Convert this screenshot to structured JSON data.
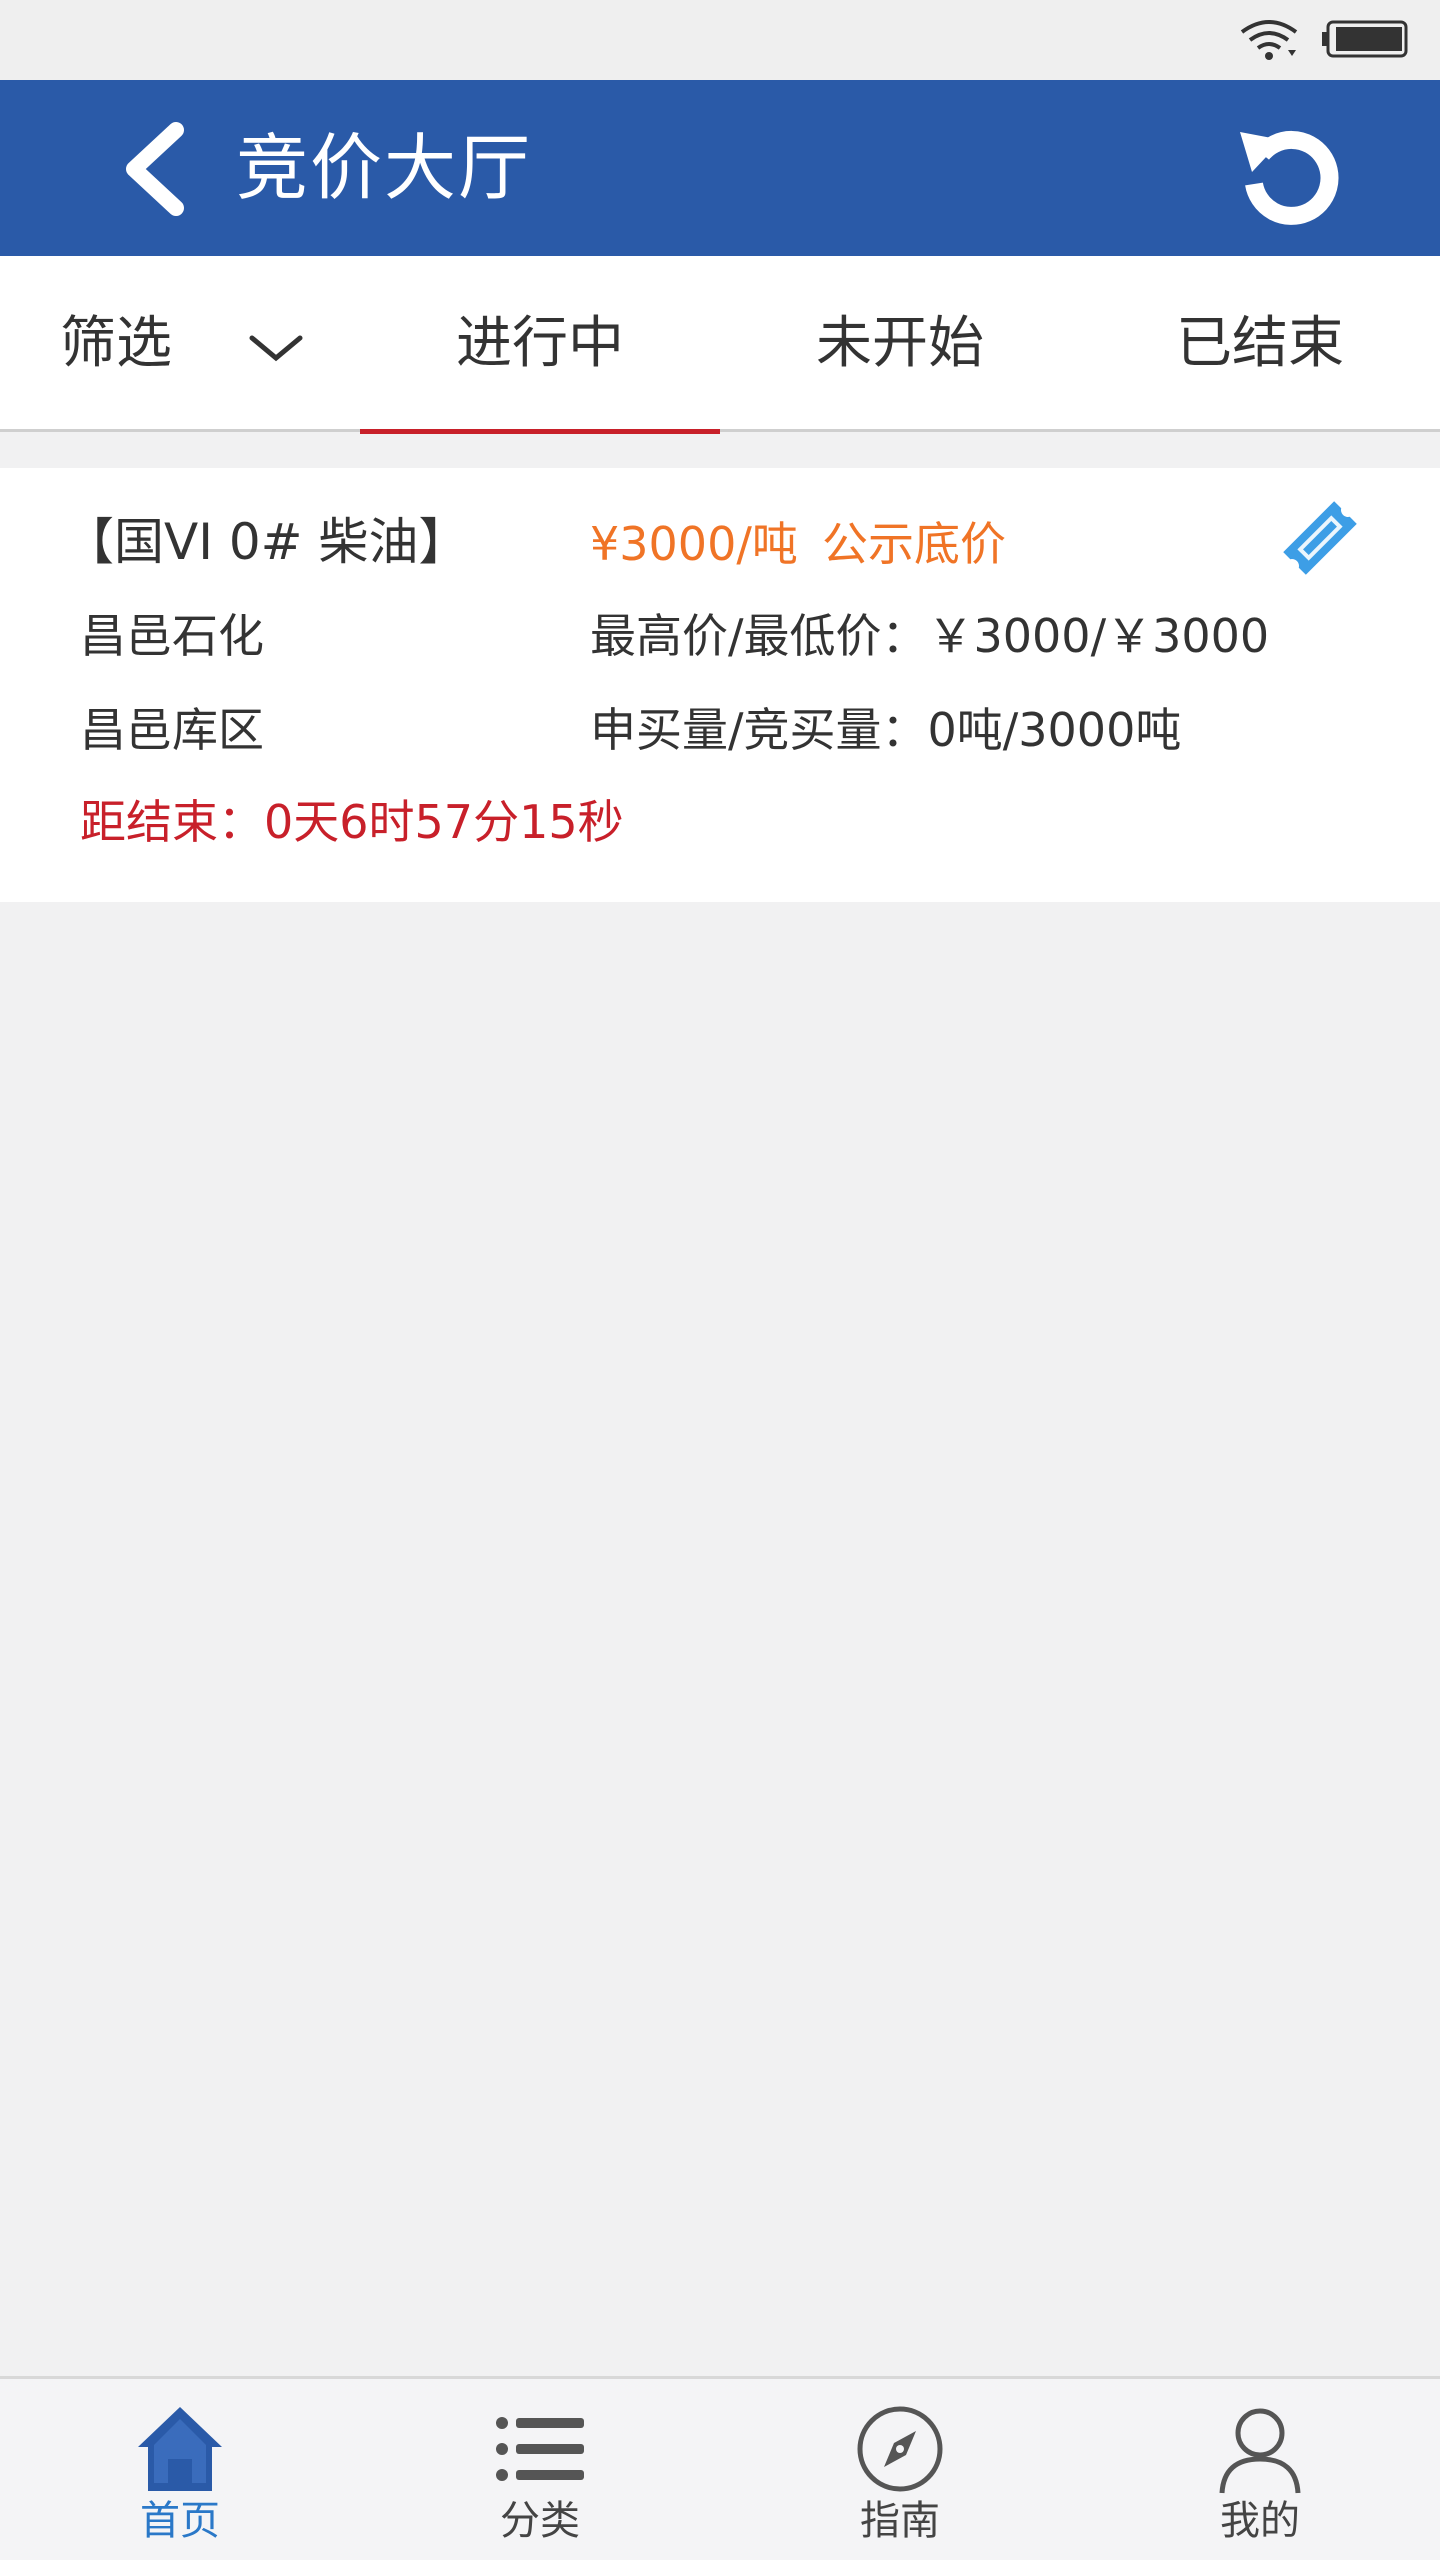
{
  "colors": {
    "header_bg": "#2a5aa8",
    "accent_red": "#c8202a",
    "accent_orange": "#f07426",
    "nav_active": "#2a78c8",
    "ticket_blue": "#3d9ee6"
  },
  "header": {
    "title": "竞价大厅",
    "back_icon": "chevron-left-icon",
    "refresh_icon": "refresh-icon"
  },
  "tabs": {
    "filter_label": "筛选",
    "items": [
      {
        "label": "进行中",
        "active": true
      },
      {
        "label": "未开始",
        "active": false
      },
      {
        "label": "已结束",
        "active": false
      }
    ]
  },
  "listing": {
    "product": "【国VI 0# 柴油】",
    "price": "¥3000/吨",
    "price_tag": "公示底价",
    "company": "昌邑石化",
    "price_range": "最高价/最低价：￥3000/￥3000",
    "depot": "昌邑库区",
    "volume": "申买量/竞买量：0吨/3000吨",
    "countdown": "距结束：0天6时57分15秒"
  },
  "bottom_nav": [
    {
      "label": "首页",
      "icon": "home-icon",
      "active": true
    },
    {
      "label": "分类",
      "icon": "list-icon",
      "active": false
    },
    {
      "label": "指南",
      "icon": "compass-icon",
      "active": false
    },
    {
      "label": "我的",
      "icon": "user-icon",
      "active": false
    }
  ]
}
